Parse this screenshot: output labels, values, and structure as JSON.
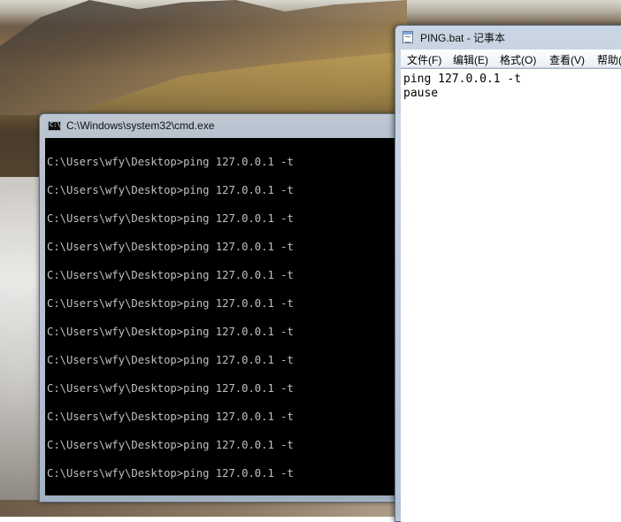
{
  "desktop": {
    "wallpaper": "mountain-waterfall-landscape"
  },
  "cmd_window": {
    "title": "C:\\Windows\\system32\\cmd.exe",
    "icon": "console-icon",
    "background": "#000000",
    "text_color": "#c0c0c0",
    "lines": [
      "C:\\Users\\wfy\\Desktop>ping 127.0.0.1 -t",
      "C:\\Users\\wfy\\Desktop>ping 127.0.0.1 -t",
      "C:\\Users\\wfy\\Desktop>ping 127.0.0.1 -t",
      "C:\\Users\\wfy\\Desktop>ping 127.0.0.1 -t",
      "C:\\Users\\wfy\\Desktop>ping 127.0.0.1 -t",
      "C:\\Users\\wfy\\Desktop>ping 127.0.0.1 -t",
      "C:\\Users\\wfy\\Desktop>ping 127.0.0.1 -t",
      "C:\\Users\\wfy\\Desktop>ping 127.0.0.1 -t",
      "C:\\Users\\wfy\\Desktop>ping 127.0.0.1 -t",
      "C:\\Users\\wfy\\Desktop>ping 127.0.0.1 -t",
      "C:\\Users\\wfy\\Desktop>ping 127.0.0.1 -t",
      "C:\\Users\\wfy\\Desktop>ping 127.0.0.1 -t"
    ]
  },
  "notepad_window": {
    "title": "PING.bat - 记事本",
    "icon": "notepad-icon",
    "menu": [
      {
        "label": "文件(F)"
      },
      {
        "label": "编辑(E)"
      },
      {
        "label": "格式(O)"
      },
      {
        "label": "查看(V)"
      },
      {
        "label": "帮助("
      }
    ],
    "content_lines": [
      "ping 127.0.0.1 -t",
      "pause"
    ]
  }
}
